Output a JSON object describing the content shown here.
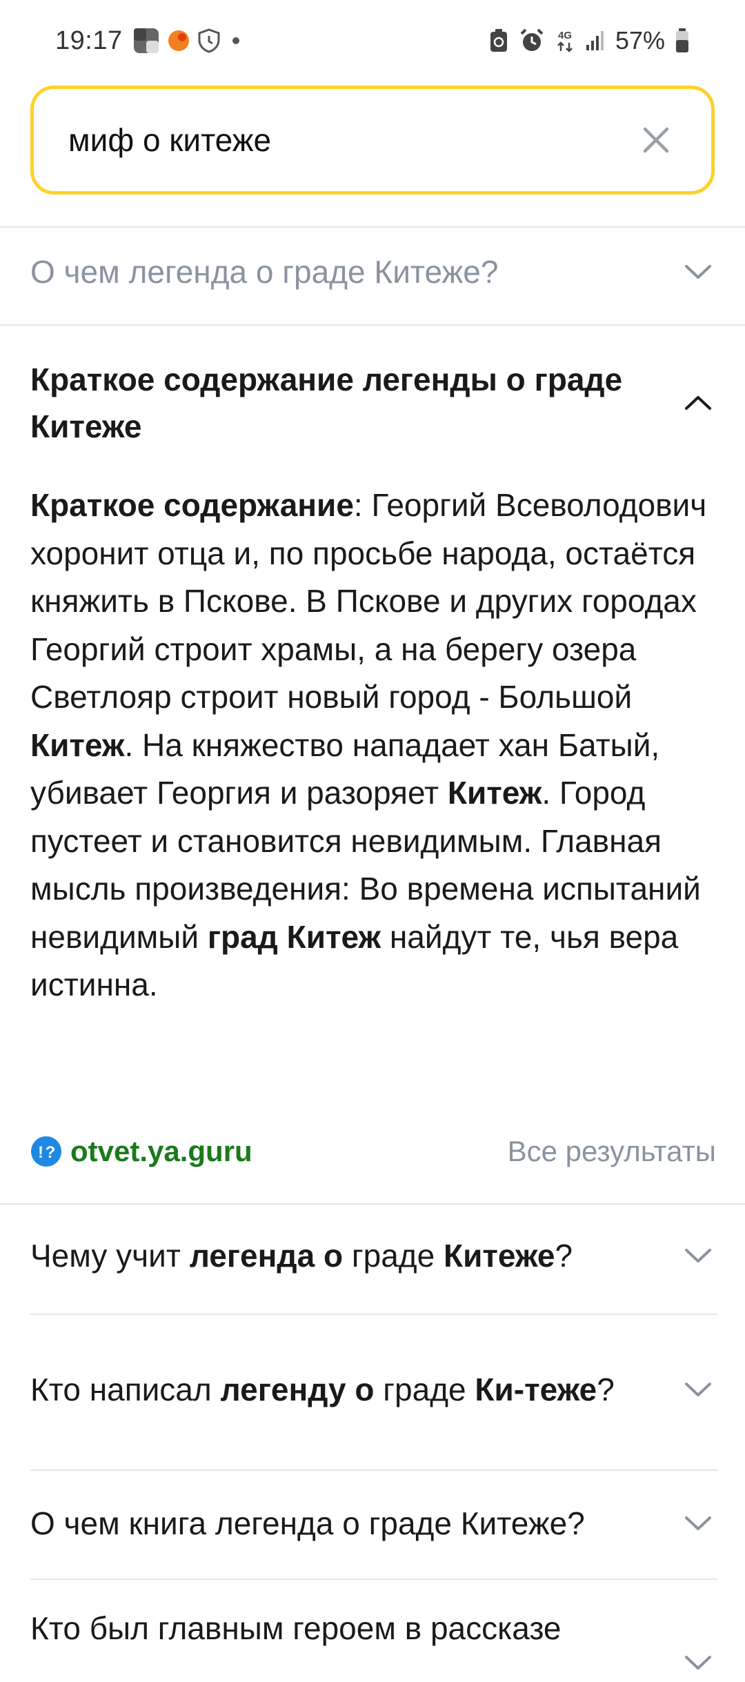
{
  "status_bar": {
    "time": "19:17",
    "network": "4G",
    "battery": "57%"
  },
  "search": {
    "query": "миф о китеже",
    "placeholder": ""
  },
  "faq": [
    {
      "question": "О чем легенда о граде Китеже?",
      "state": "collapsed"
    },
    {
      "question": "Краткое содержание легенды о граде Китеже",
      "state": "expanded",
      "answer": {
        "parts": [
          {
            "text": "Краткое содержание",
            "bold": true
          },
          {
            "text": ": Георгий Всеволодович хоронит отца и, по просьбе народа, остаётся княжить в Пскове. В Пскове и других городах Георгий строит храмы, а на берегу озера Светлояр строит новый город - Большой ",
            "bold": false
          },
          {
            "text": "Китеж",
            "bold": true
          },
          {
            "text": ". На княжество нападает хан Батый, убивает Георгия и разоряет ",
            "bold": false
          },
          {
            "text": "Китеж",
            "bold": true
          },
          {
            "text": ". Город пустеет и становится невидимым. Главная мысль произведения: Во времена испытаний невидимый ",
            "bold": false
          },
          {
            "text": "град Китеж",
            "bold": true
          },
          {
            "text": " найдут те, чья вера истинна.",
            "bold": false
          }
        ],
        "source": "otvet.ya.guru",
        "all_results": "Все результаты"
      }
    },
    {
      "question_parts": [
        {
          "text": "Чему учит ",
          "bold": false
        },
        {
          "text": "легенда о",
          "bold": true
        },
        {
          "text": " граде ",
          "bold": false
        },
        {
          "text": "Китеже",
          "bold": true
        },
        {
          "text": "?",
          "bold": false
        }
      ],
      "state": "collapsed"
    },
    {
      "question_parts": [
        {
          "text": "Кто написал ",
          "bold": false
        },
        {
          "text": "легенду о",
          "bold": true
        },
        {
          "text": " граде ",
          "bold": false
        },
        {
          "text": "Ки-теже",
          "bold": true
        },
        {
          "text": "?",
          "bold": false
        }
      ],
      "state": "collapsed"
    },
    {
      "question": "О чем книга легенда о граде Китеже?",
      "state": "collapsed"
    },
    {
      "question": "Кто был главным героем в рассказе",
      "state": "collapsed"
    }
  ],
  "colors": {
    "search_border": "#fcd22a",
    "source_link": "#1a7a1a",
    "muted_text": "#8a93a0",
    "divider": "#e6e6e6"
  }
}
